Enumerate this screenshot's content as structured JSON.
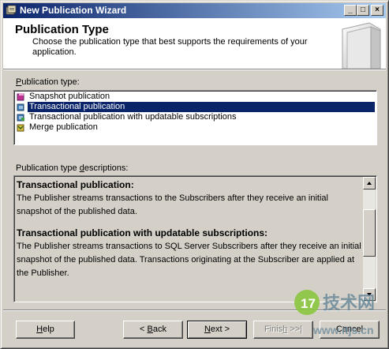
{
  "window": {
    "title": "New Publication Wizard"
  },
  "titlebar_buttons": {
    "minimize": "_",
    "maximize": "□",
    "close": "×"
  },
  "header": {
    "title": "Publication Type",
    "description": "Choose the publication type that best supports the requirements of your application."
  },
  "publication_type": {
    "label_prefix": "",
    "label_accel": "P",
    "label_rest": "ublication type:",
    "items": [
      {
        "label": "Snapshot publication",
        "icon": "snapshot-publication-icon",
        "selected": false
      },
      {
        "label": "Transactional publication",
        "icon": "transactional-publication-icon",
        "selected": true
      },
      {
        "label": "Transactional publication with updatable subscriptions",
        "icon": "transactional-updatable-icon",
        "selected": false
      },
      {
        "label": "Merge publication",
        "icon": "merge-publication-icon",
        "selected": false
      }
    ]
  },
  "descriptions": {
    "label_prefix": "Publication type ",
    "label_accel": "d",
    "label_rest": "escriptions:",
    "sections": [
      {
        "heading": "Transactional publication:",
        "body": "The Publisher streams transactions to the Subscribers after they receive an initial snapshot of the published data."
      },
      {
        "heading": "Transactional publication with updatable subscriptions:",
        "body": "The Publisher streams transactions to SQL Server Subscribers after they receive an initial snapshot of the published data. Transactions originating at the Subscriber are applied at the Publisher."
      }
    ]
  },
  "buttons": {
    "help_accel": "H",
    "help_rest": "elp",
    "back_prefix": "< ",
    "back_accel": "B",
    "back_rest": "ack",
    "next_accel": "N",
    "next_rest": "ext >",
    "finish_prefix": "Finis",
    "finish_accel": "h",
    "finish_rest": " >>|",
    "cancel": "Cancel"
  },
  "watermark": {
    "text": "技术网",
    "number": "17",
    "url": "www.itjs.cn"
  },
  "colors": {
    "selection": "#0a246a",
    "title_gradient_start": "#0a246a",
    "title_gradient_end": "#a6caf0",
    "face": "#d4d0c8"
  }
}
